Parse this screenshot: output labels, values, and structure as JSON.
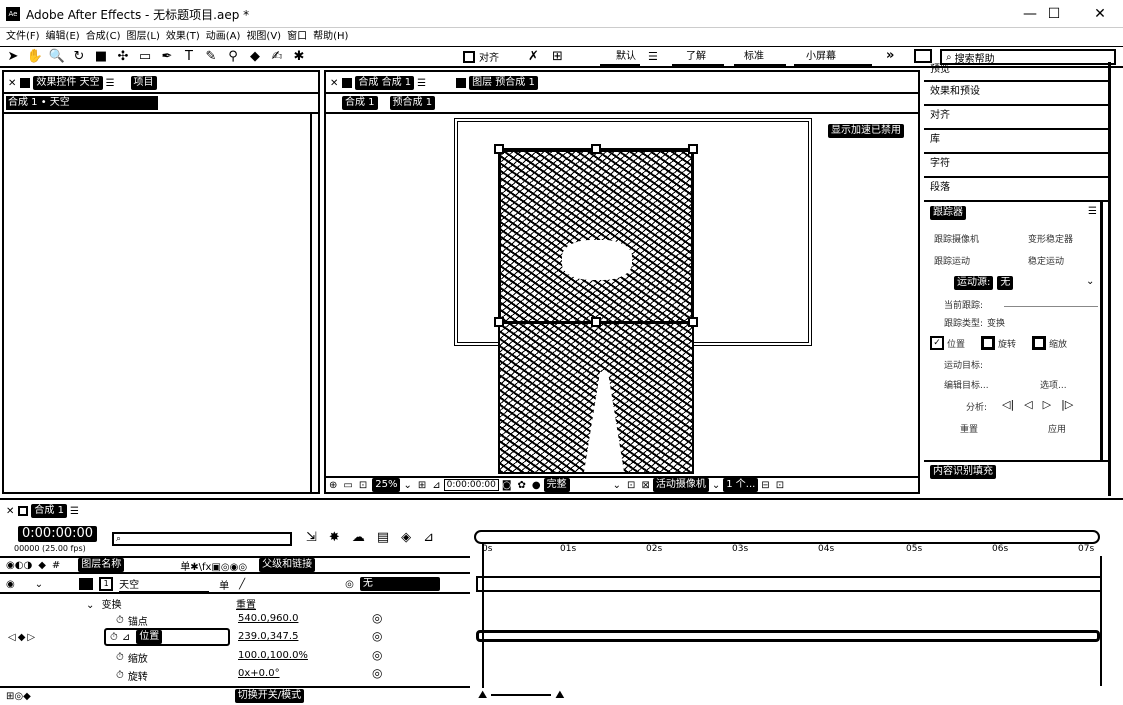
{
  "window": {
    "app_icon": "Ae",
    "title": "Adobe After Effects - 无标题项目.aep *",
    "minimize": "—",
    "maximize": "☐",
    "close": "✕"
  },
  "menu": [
    "文件(F)",
    "编辑(E)",
    "合成(C)",
    "图层(L)",
    "效果(T)",
    "动画(A)",
    "视图(V)",
    "窗口",
    "帮助(H)"
  ],
  "toolbar": {
    "align_label": "对齐",
    "workspaces": [
      "默认",
      "了解",
      "标准",
      "小屏幕"
    ],
    "more": "»",
    "search_placeholder": "搜索帮助"
  },
  "effects_panel": {
    "tab_effects": "效果控件 天空",
    "tab_project": "项目",
    "breadcrumb": "合成 1 • 天空"
  },
  "comp_panel": {
    "tab_comp": "合成 合成 1",
    "tab_layer": "图层 预合成 1",
    "sub_tab_1": "合成 1",
    "sub_tab_2": "预合成 1",
    "accel_notice": "显示加速已禁用",
    "zoom": "25%",
    "timecode": "0:00:00:00",
    "quality": "完整",
    "camera": "活动摄像机",
    "views": "1 个..."
  },
  "right_panel": {
    "items": [
      "预览",
      "效果和预设",
      "对齐",
      "库",
      "字符",
      "段落"
    ],
    "tracker": {
      "title": "跟踪器",
      "btn1": "跟踪摄像机",
      "btn2": "变形稳定器",
      "btn3": "跟踪运动",
      "btn4": "稳定运动",
      "motion_source_label": "运动源:",
      "motion_source_value": "无",
      "current_track_label": "当前跟踪:",
      "track_type_label": "跟踪类型:",
      "track_type_value": "变换",
      "cb_position": "位置",
      "cb_rotation": "旋转",
      "cb_scale": "缩放",
      "motion_target": "运动目标:",
      "edit_target": "编辑目标...",
      "options": "选项...",
      "analyze": "分析:",
      "reset": "重置",
      "apply": "应用"
    },
    "content_fill": "内容识别填充"
  },
  "timeline": {
    "tab": "合成 1",
    "timecode": "0:00:00:00",
    "fps": "00000 (25.00 fps)",
    "col_layer_name": "图层名称",
    "col_parent": "父级和链接",
    "ruler_ticks": [
      "0s",
      "01s",
      "02s",
      "03s",
      "04s",
      "05s",
      "06s",
      "07s"
    ],
    "layers": [
      {
        "index": "1",
        "name": "天空",
        "parent": "无"
      }
    ],
    "props": [
      {
        "name": "变换",
        "value": "重置"
      },
      {
        "name": "锚点",
        "value": "540.0,960.0"
      },
      {
        "name": "位置",
        "value": "239.0,347.5"
      },
      {
        "name": "缩放",
        "value": "100.0,100.0%"
      },
      {
        "name": "旋转",
        "value": "0x+0.0°"
      }
    ],
    "toggle_switches": "切换开关/模式"
  }
}
